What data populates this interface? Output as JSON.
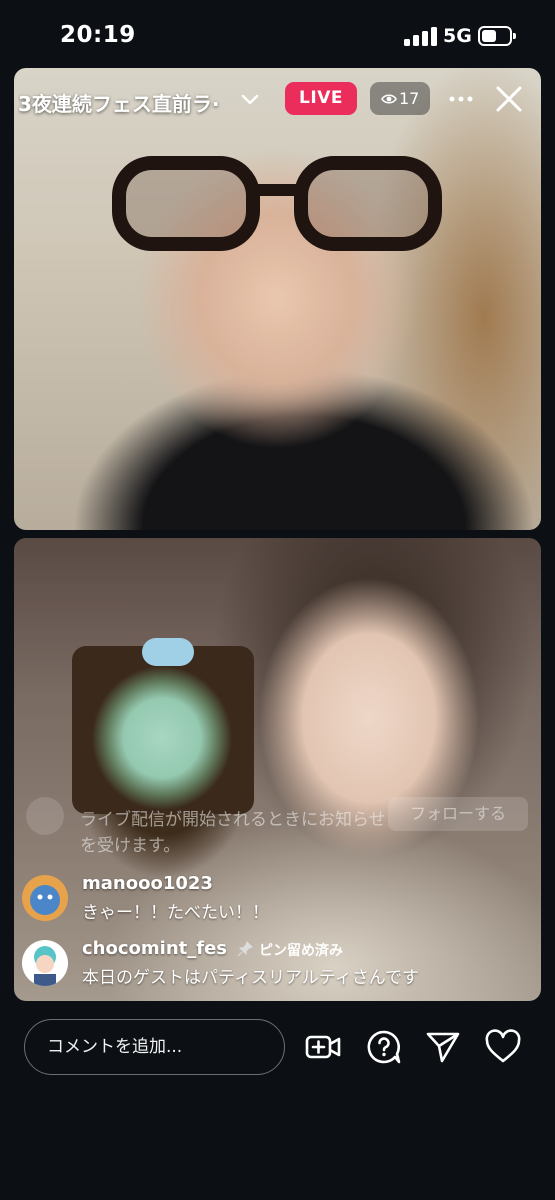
{
  "status_bar": {
    "time": "20:19",
    "network": "5G"
  },
  "stream": {
    "title": "3夜連続フェス直前ラ·",
    "live_label": "LIVE",
    "viewer_count": "17",
    "accent_color": "#ea2d5a"
  },
  "ghost_comment": {
    "text": "ライブ配信が開始されるときにお知らせを受けます。",
    "follow_label": "フォローする"
  },
  "comments": [
    {
      "username": "manooo1023",
      "message": "きゃー！！たべたい！！"
    },
    {
      "username": "chocomint_fes",
      "message": "本日のゲストはパティスリアルティさんです",
      "pinned_label": "ピン留め済み"
    }
  ],
  "bottom_bar": {
    "comment_placeholder": "コメントを追加...",
    "icons": [
      "add-video-icon",
      "question-icon",
      "send-icon",
      "heart-icon"
    ]
  }
}
